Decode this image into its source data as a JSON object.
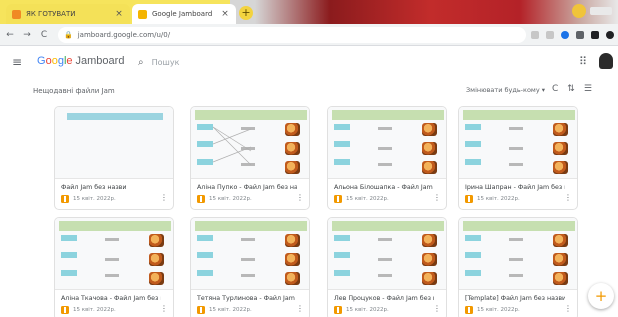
{
  "browser": {
    "tabs": [
      {
        "label": "ЯК ГОТУВАТИ"
      },
      {
        "label": "Google Jamboard"
      }
    ],
    "url": "jamboard.google.com/u/0/"
  },
  "header": {
    "logo_google": [
      "G",
      "o",
      "o",
      "g",
      "l",
      "e"
    ],
    "logo_product": "Jamboard",
    "search_placeholder": "Пошук"
  },
  "content": {
    "section_title": "Нещодавні файли Jam",
    "sort_label": "Змінювати будь-кому"
  },
  "cards": [
    {
      "title": "Файл Jam без назви",
      "date": "15 квіт. 2022р.",
      "type": "blank"
    },
    {
      "title": "Аліна Пупко - Файл Jam без наз...",
      "date": "15 квіт. 2022р.",
      "type": "links"
    },
    {
      "title": "Альона Білошапка - Файл Jam б...",
      "date": "15 квіт. 2022р.",
      "type": "food"
    },
    {
      "title": "Ірина Шапран - Файл Jam без н...",
      "date": "15 квіт. 2022р.",
      "type": "food"
    },
    {
      "title": "Аліна Ткачова - Файл Jam без н...",
      "date": "15 квіт. 2022р.",
      "type": "food"
    },
    {
      "title": "Тетяна Турлинова - Файл Jam б...",
      "date": "15 квіт. 2022р.",
      "type": "food"
    },
    {
      "title": "Лев Процуков - Файл Jam без н...",
      "date": "15 квіт. 2022р.",
      "type": "food"
    },
    {
      "title": "[Template] Файл Jam без назви",
      "date": "15 квіт. 2022р.",
      "type": "food"
    }
  ],
  "fab_label": "+"
}
